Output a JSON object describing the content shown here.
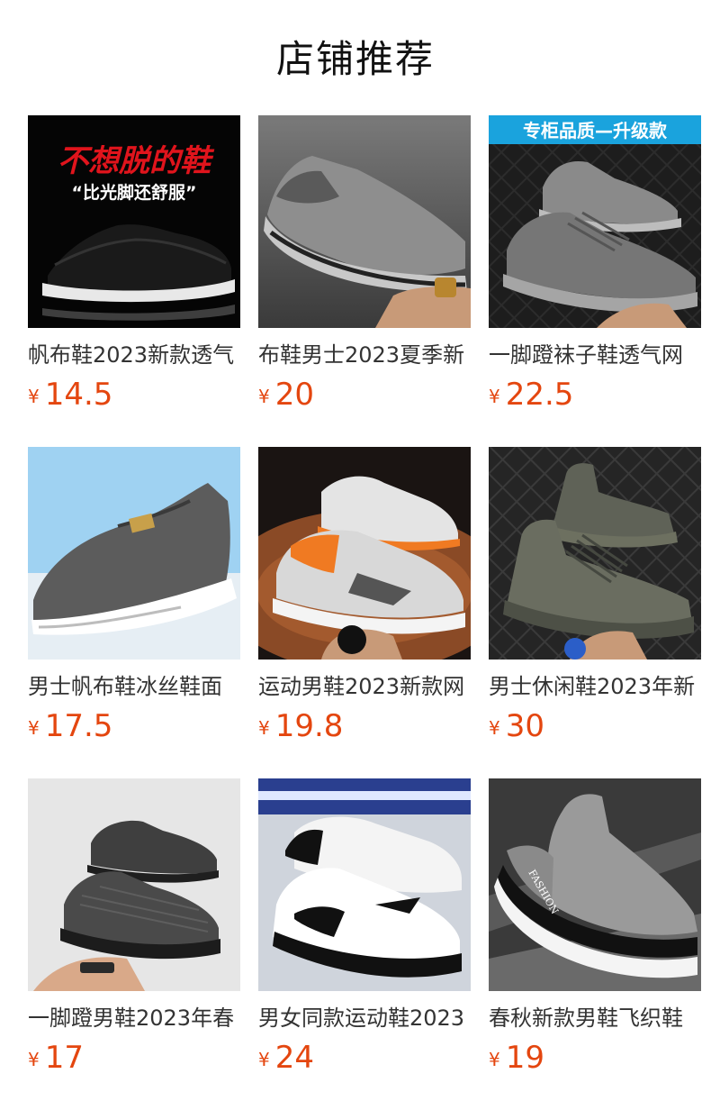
{
  "header": {
    "title": "店铺推荐"
  },
  "colors": {
    "price": "#e4460f"
  },
  "products": [
    {
      "name": "帆布鞋2023新款透气",
      "currency": "¥",
      "price": "14.5",
      "banner": "不想脱的鞋",
      "sub_banner": "“比光脚还舒服”",
      "icon": "black-slip-on-shoe-image"
    },
    {
      "name": "布鞋男士2023夏季新",
      "currency": "¥",
      "price": "20",
      "icon": "gray-canvas-loafer-image"
    },
    {
      "name": "一脚蹬袜子鞋透气网",
      "currency": "¥",
      "price": "22.5",
      "banner": "专柜品质—升级款",
      "icon": "gray-knit-sock-shoe-image"
    },
    {
      "name": "男士帆布鞋冰丝鞋面",
      "currency": "¥",
      "price": "17.5",
      "icon": "gray-slip-on-shoe-image"
    },
    {
      "name": "运动男鞋2023新款网",
      "currency": "¥",
      "price": "19.8",
      "icon": "orange-running-sneaker-image"
    },
    {
      "name": "男士休闲鞋2023年新",
      "currency": "¥",
      "price": "30",
      "icon": "olive-knit-sneaker-image"
    },
    {
      "name": "一脚蹬男鞋2023年春",
      "currency": "¥",
      "price": "17",
      "icon": "dark-knit-slip-on-image"
    },
    {
      "name": "男女同款运动鞋2023",
      "currency": "¥",
      "price": "24",
      "icon": "white-black-sneaker-image"
    },
    {
      "name": "春秋新款男鞋飞织鞋",
      "currency": "¥",
      "price": "19",
      "icon": "gray-fashion-sock-shoe-image"
    }
  ]
}
